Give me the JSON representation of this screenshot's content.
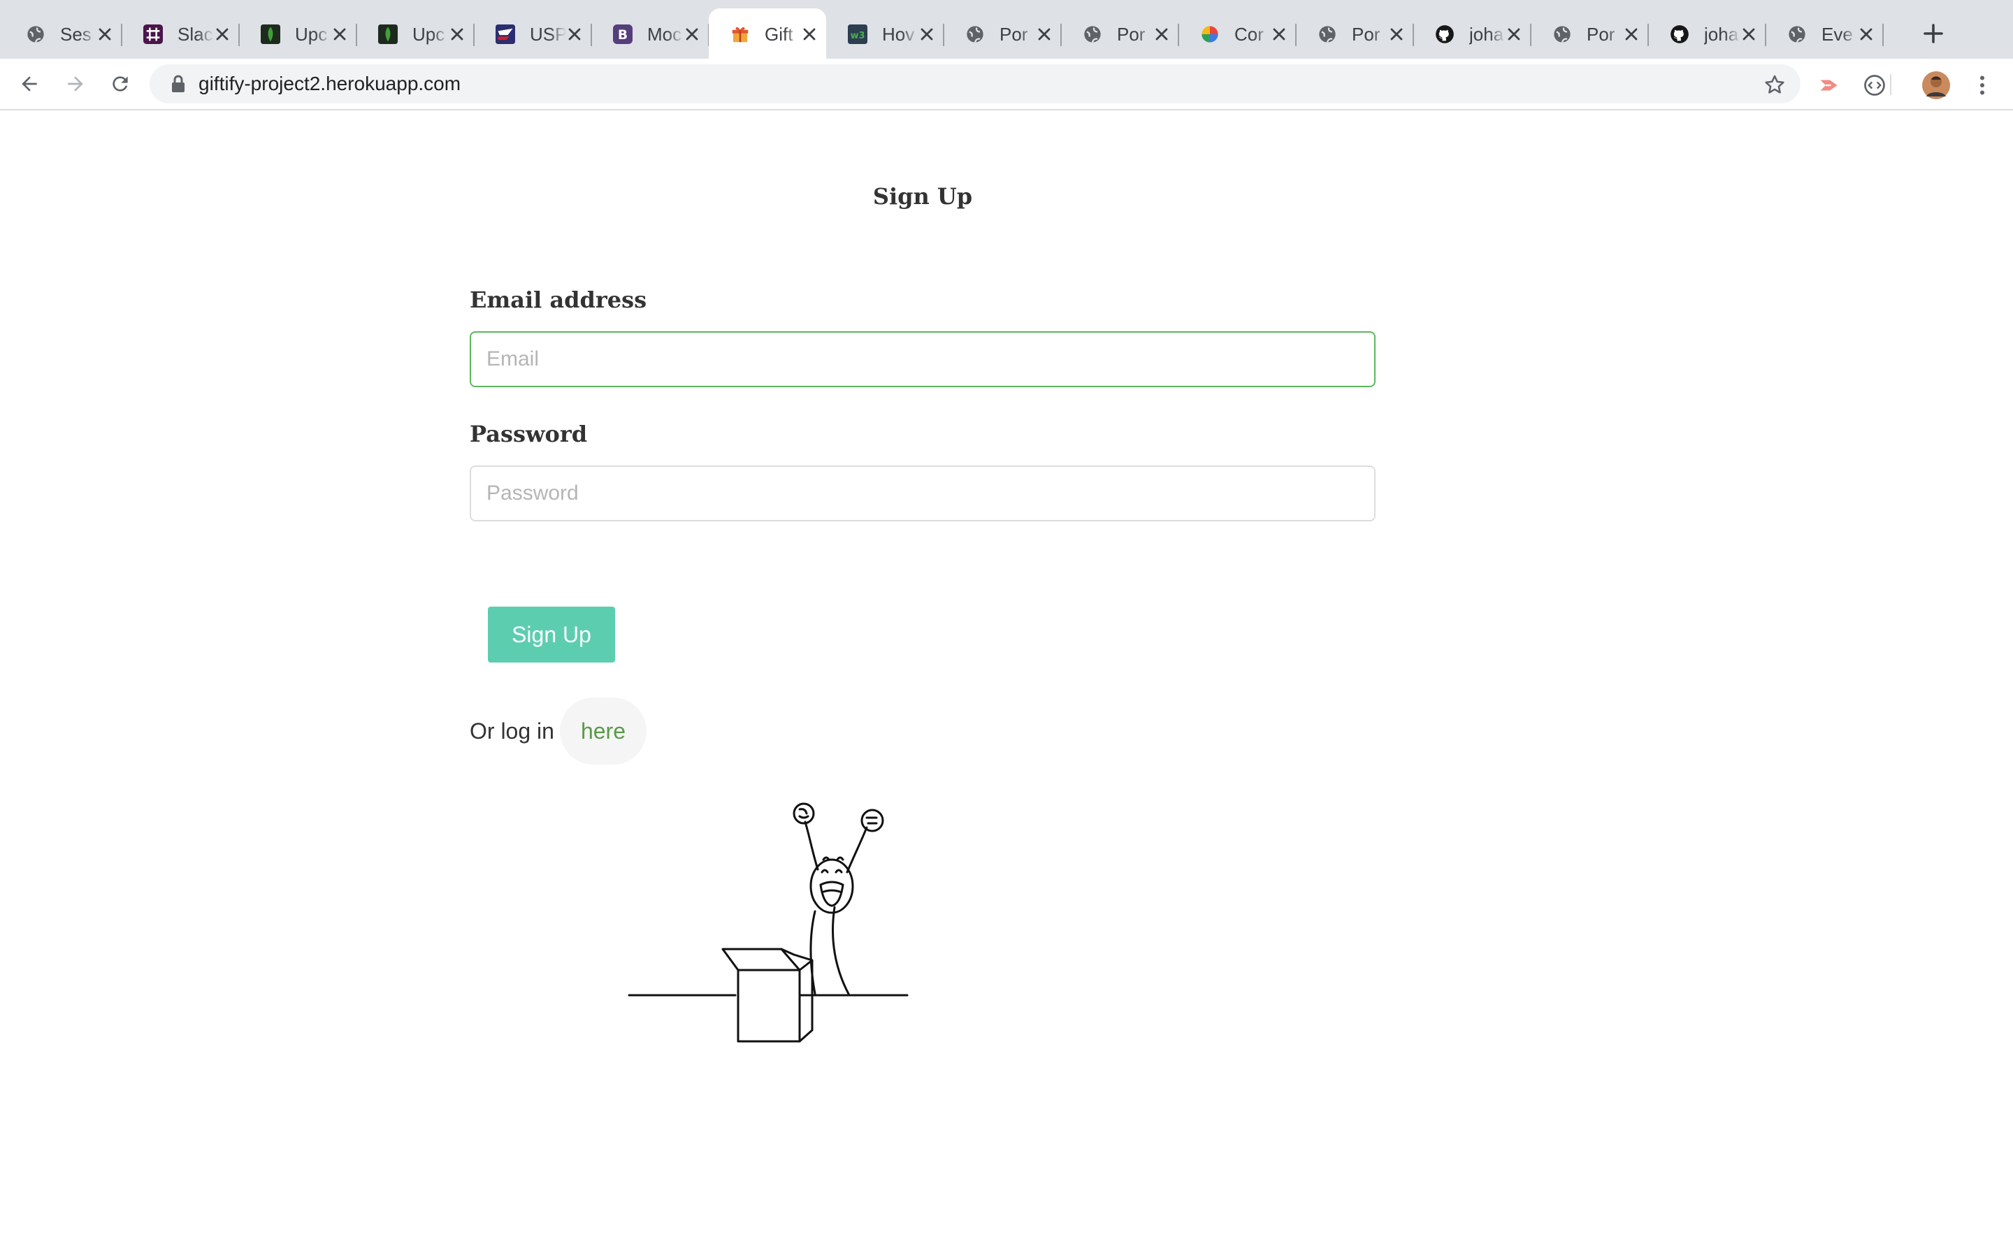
{
  "browser": {
    "tabs": [
      {
        "title": "Ses",
        "icon": "globe-icon",
        "active": false
      },
      {
        "title": "Slac",
        "icon": "slack-icon",
        "active": false
      },
      {
        "title": "Upc",
        "icon": "mongodb-leaf-icon",
        "active": false
      },
      {
        "title": "Upc",
        "icon": "mongodb-leaf-icon",
        "active": false
      },
      {
        "title": "USP",
        "icon": "usps-eagle-icon",
        "active": false
      },
      {
        "title": "Moc",
        "icon": "bootstrap-icon",
        "active": false
      },
      {
        "title": "Gift",
        "icon": "gift-icon",
        "active": true
      },
      {
        "title": "Hov",
        "icon": "w3schools-icon",
        "active": false
      },
      {
        "title": "Por",
        "icon": "globe-icon",
        "active": false
      },
      {
        "title": "Por",
        "icon": "globe-icon",
        "active": false
      },
      {
        "title": "Cor",
        "icon": "colorful-ball-icon",
        "active": false
      },
      {
        "title": "Por",
        "icon": "globe-icon",
        "active": false
      },
      {
        "title": "joha",
        "icon": "github-icon",
        "active": false
      },
      {
        "title": "Por",
        "icon": "globe-icon",
        "active": false
      },
      {
        "title": "joha",
        "icon": "github-icon",
        "active": false
      },
      {
        "title": "Eve",
        "icon": "globe-icon",
        "active": false
      }
    ],
    "url": "giftify-project2.herokuapp.com"
  },
  "page": {
    "title": "Sign Up",
    "email": {
      "label": "Email address",
      "placeholder": "Email",
      "value": ""
    },
    "password": {
      "label": "Password",
      "placeholder": "Password",
      "value": ""
    },
    "submit_label": "Sign Up",
    "login_prompt": "Or log in",
    "login_link": "here"
  },
  "colors": {
    "accent_button": "#5dcdb0",
    "focus_border": "#5cb85c",
    "link": "#5a9a4a"
  }
}
